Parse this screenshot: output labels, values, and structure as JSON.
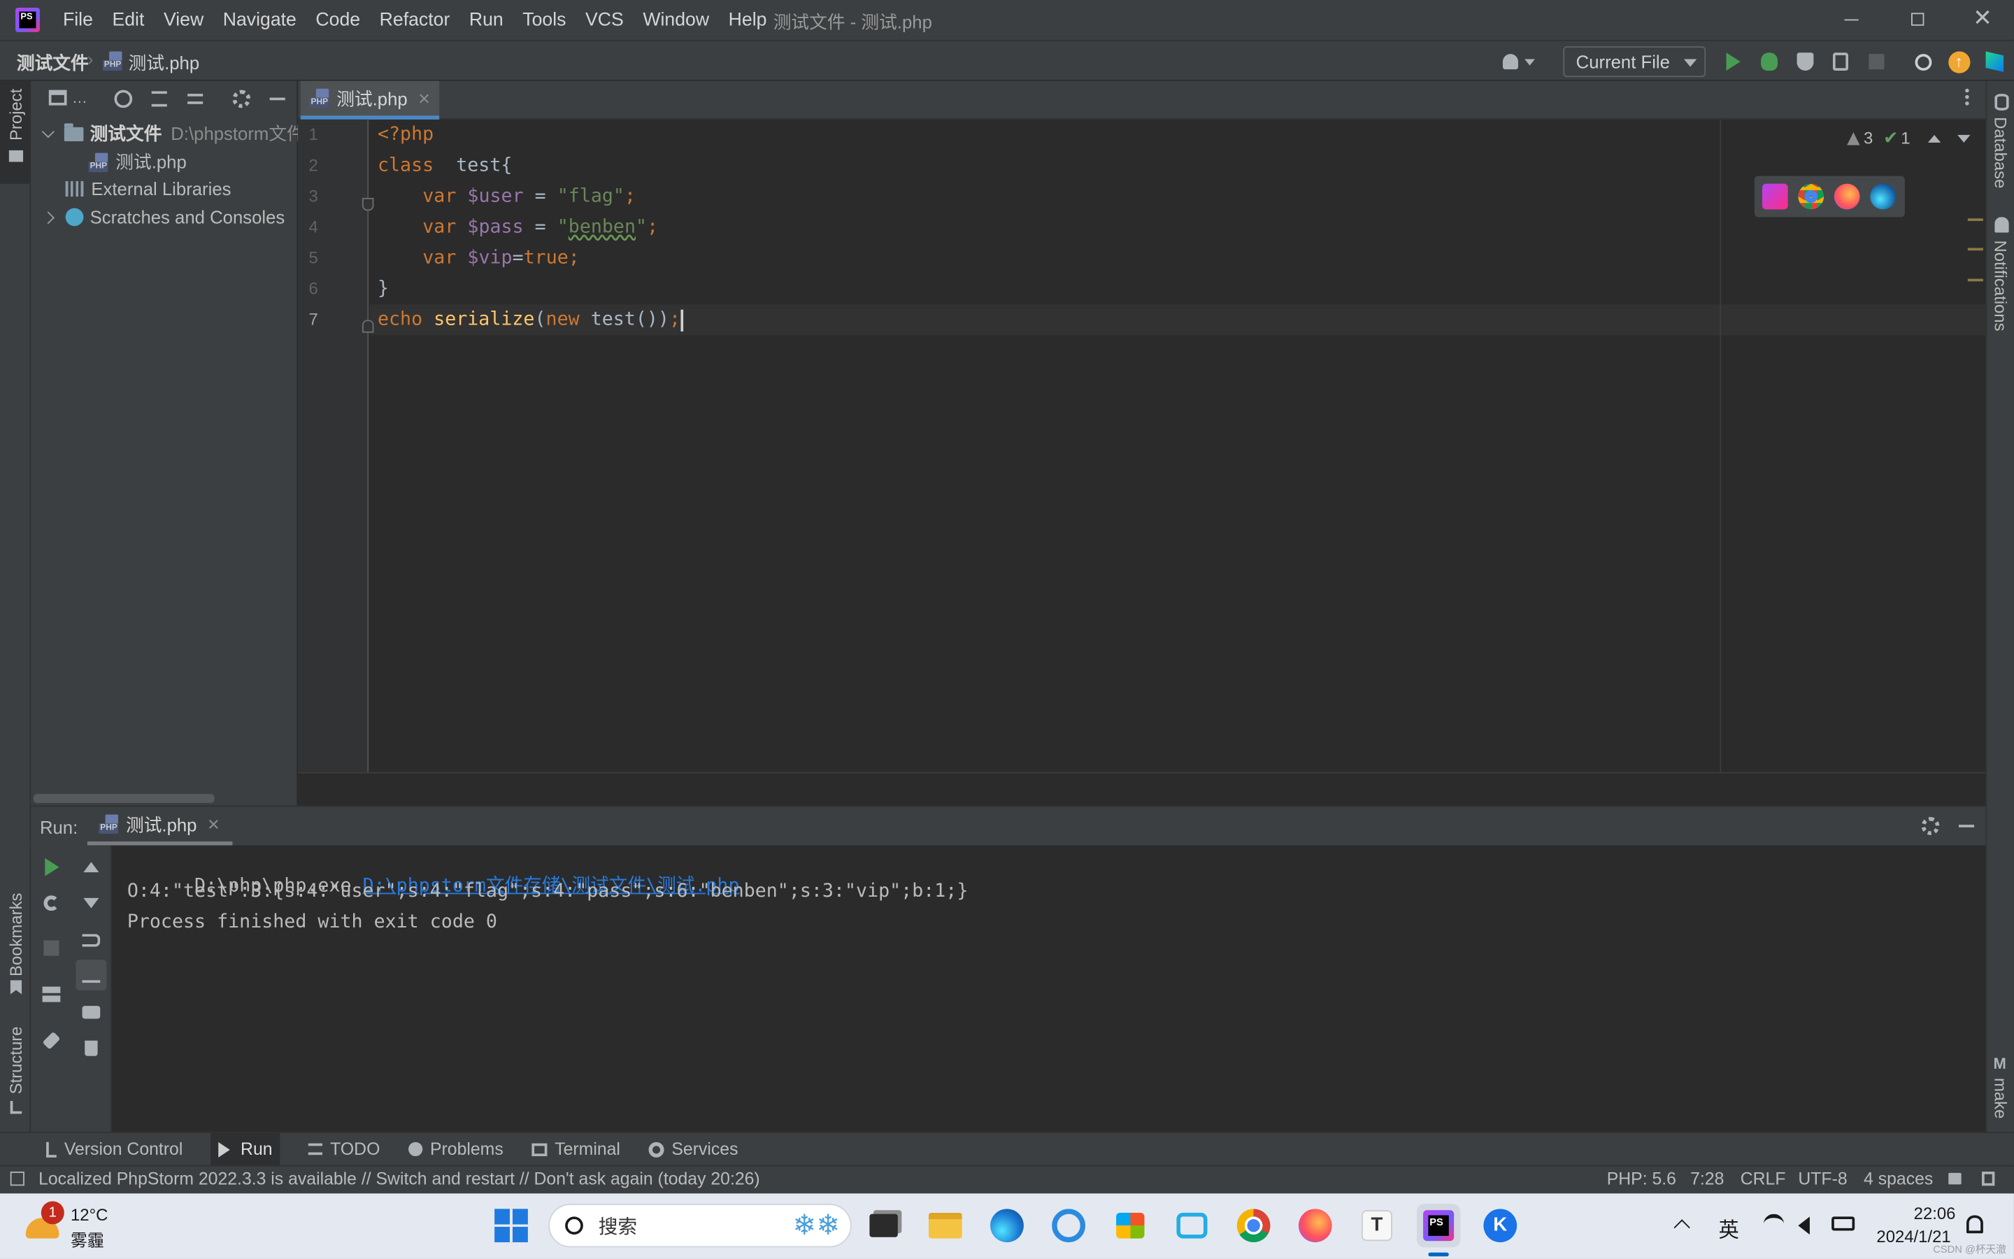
{
  "window": {
    "title": "测试文件 - 测试.php",
    "menu": [
      "File",
      "Edit",
      "View",
      "Navigate",
      "Code",
      "Refactor",
      "Run",
      "Tools",
      "VCS",
      "Window",
      "Help"
    ],
    "menu_mnemonics": [
      "F",
      "E",
      "V",
      "N",
      "C",
      "R",
      "u",
      "T",
      "S",
      "W",
      "H"
    ]
  },
  "breadcrumb": {
    "project": "测试文件",
    "file": "测试.php"
  },
  "run_config": {
    "label": "Current File"
  },
  "left_strip": {
    "project": "Project",
    "bookmarks": "Bookmarks",
    "structure": "Structure"
  },
  "right_strip": {
    "database": "Database",
    "notifications": "Notifications",
    "make": "make"
  },
  "project_tree": {
    "root_name": "测试文件",
    "root_path": "D:\\phpstorm文件",
    "file": "测试.php",
    "external_libraries": "External Libraries",
    "scratches": "Scratches and Consoles"
  },
  "editor": {
    "tab_label": "测试.php",
    "line_numbers": [
      "1",
      "2",
      "3",
      "4",
      "5",
      "6",
      "7"
    ],
    "inspections": {
      "warnings": "3",
      "ok": "1"
    },
    "code": {
      "l1": "<?php",
      "l2_kw": "class",
      "l2_name": "  test{",
      "l3_kw": "var",
      "l3_var": " $user",
      "l3_op": " = ",
      "l3_str": "\"flag\"",
      "l3_end": ";",
      "l4_kw": "var",
      "l4_var": " $pass",
      "l4_op": " = ",
      "l4_q1": "\"",
      "l4_strw": "benben",
      "l4_q2": "\"",
      "l4_end": ";",
      "l5_kw": "var",
      "l5_var": " $vip",
      "l5_op": "=",
      "l5_val": "true",
      "l5_end": ";",
      "l6": "}",
      "l7_echo": "echo",
      "l7_fn": " serialize",
      "l7_p1": "(",
      "l7_new": "new",
      "l7_rest": " test())",
      "l7_end": ";"
    }
  },
  "run_panel": {
    "label": "Run:",
    "tab": "测试.php",
    "cmd_exe": "D:\\php\\php.exe ",
    "cmd_path": "D:\\phpstorm文件存储\\测试文件\\测试.php",
    "output": "O:4:\"test\":3:{s:4:\"user\";s:4:\"flag\";s:4:\"pass\";s:6:\"benben\";s:3:\"vip\";b:1;}",
    "exit": "Process finished with exit code 0"
  },
  "tool_tabs": [
    "Version Control",
    "Run",
    "TODO",
    "Problems",
    "Terminal",
    "Services"
  ],
  "status": {
    "message": "Localized PhpStorm 2022.3.3 is available // Switch and restart // Don't ask again (today 20:26)",
    "php": "PHP: 5.6",
    "position": "7:28",
    "line_sep": "CRLF",
    "encoding": "UTF-8",
    "indent": "4 spaces"
  },
  "taskbar": {
    "weather_temp": "12°C",
    "weather_desc": "雾霾",
    "weather_badge": "1",
    "search_placeholder": "搜索",
    "ime": "英",
    "time": "22:06",
    "date": "2024/1/21",
    "watermark": "CSDN @杯天澈"
  },
  "colors": {
    "keyword": "#cc7832",
    "string": "#6a8759",
    "variable": "#9876aa",
    "function": "#ffc66d",
    "link": "#287bde",
    "accent": "#4a88c7"
  }
}
